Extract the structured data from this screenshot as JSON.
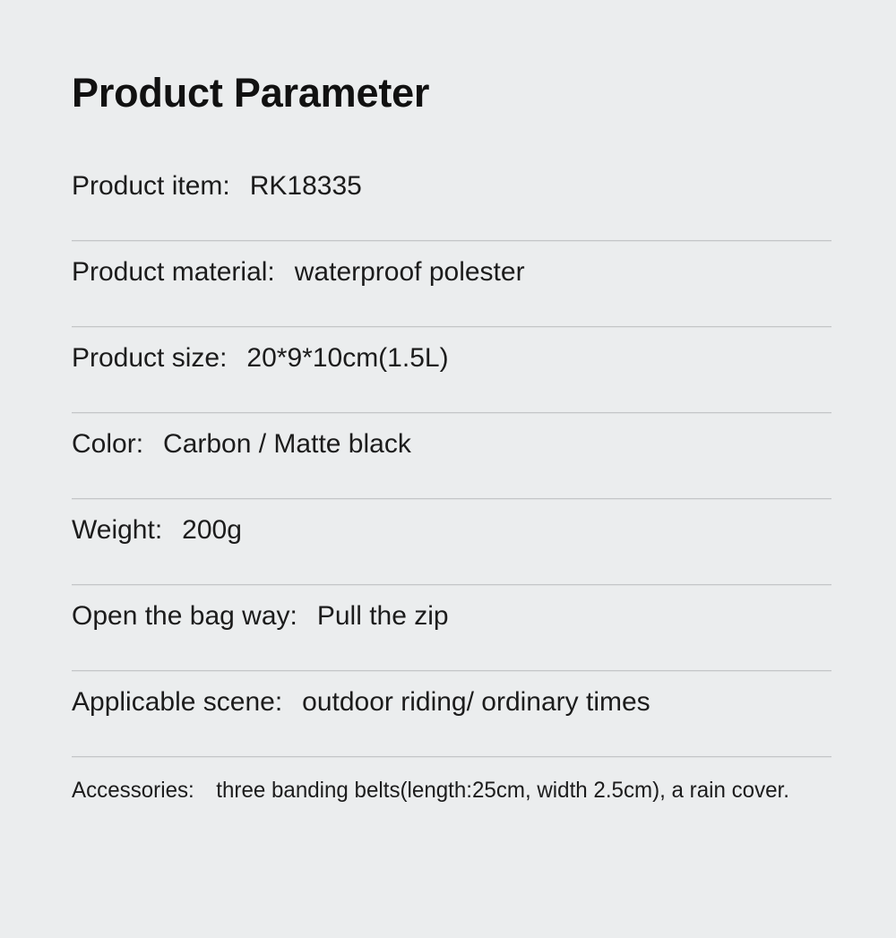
{
  "page": {
    "background_color": "#ebedee",
    "text_color": "#1c1c1c",
    "rule_color": "#c4c6c8"
  },
  "spec_card": {
    "title": "Product Parameter",
    "rows": [
      {
        "label": "Product item:",
        "value": "RK18335"
      },
      {
        "label": "Product material:",
        "value": "waterproof polester"
      },
      {
        "label": "Product size:",
        "value": "20*9*10cm(1.5L)"
      },
      {
        "label": "Color:",
        "value": "Carbon  /  Matte black"
      },
      {
        "label": "Weight:",
        "value": "200g"
      },
      {
        "label": "Open the bag way:",
        "value": "Pull the zip"
      },
      {
        "label": "Applicable scene:",
        "value": "outdoor riding/ ordinary times"
      },
      {
        "label": "Accessories:",
        "value": "three banding belts(length:25cm, width 2.5cm), a rain cover."
      }
    ]
  }
}
